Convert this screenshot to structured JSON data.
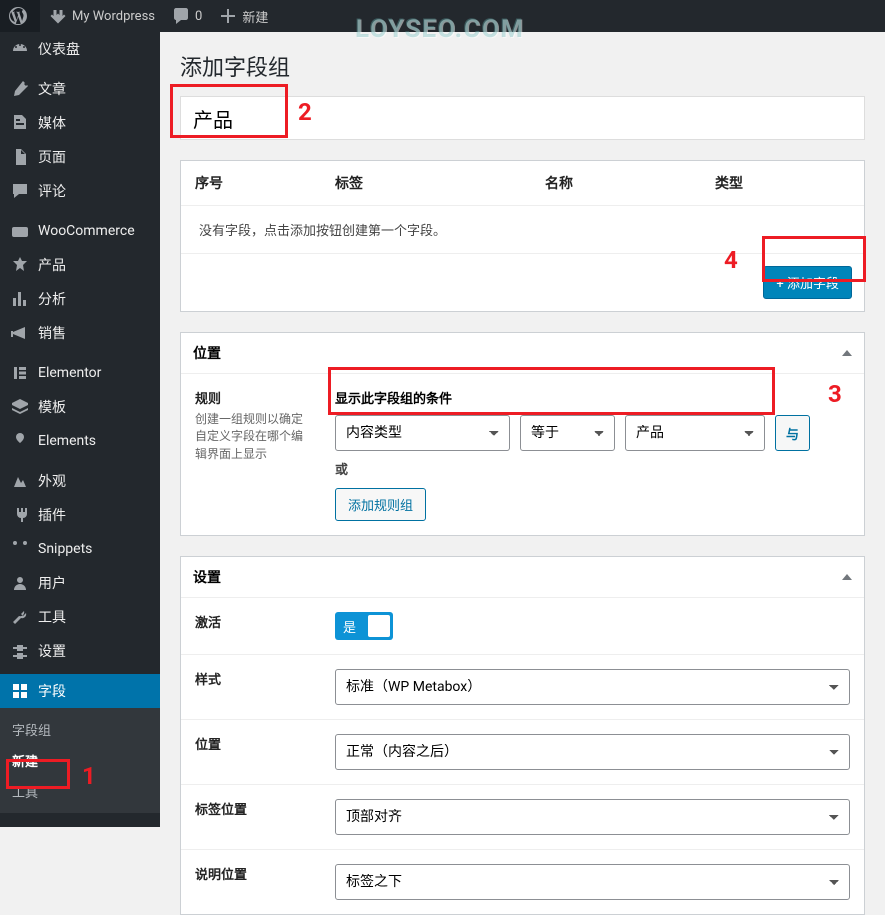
{
  "topbar": {
    "site": "My Wordpress",
    "comments": "0",
    "new": "新建"
  },
  "sidebar": {
    "items": [
      {
        "label": "仪表盘"
      },
      {
        "label": "文章"
      },
      {
        "label": "媒体"
      },
      {
        "label": "页面"
      },
      {
        "label": "评论"
      },
      {
        "label": "WooCommerce"
      },
      {
        "label": "产品"
      },
      {
        "label": "分析"
      },
      {
        "label": "销售"
      },
      {
        "label": "Elementor"
      },
      {
        "label": "模板"
      },
      {
        "label": "Elements"
      },
      {
        "label": "外观"
      },
      {
        "label": "插件"
      },
      {
        "label": "Snippets"
      },
      {
        "label": "用户"
      },
      {
        "label": "工具"
      },
      {
        "label": "设置"
      },
      {
        "label": "字段"
      }
    ],
    "sub": [
      {
        "label": "字段组"
      },
      {
        "label": "新建"
      },
      {
        "label": "工具"
      }
    ]
  },
  "page": {
    "heading": "添加字段组",
    "title_value": "产品"
  },
  "table": {
    "col_order": "序号",
    "col_label": "标签",
    "col_name": "名称",
    "col_type": "类型",
    "empty": "没有字段，点击添加按钮创建第一个字段。",
    "add": "+ 添加字段"
  },
  "location": {
    "title": "位置",
    "rules_label": "规则",
    "rules_desc": "创建一组规则以确定自定义字段在哪个编辑界面上显示",
    "rule_head": "显示此字段组的条件",
    "param": "内容类型",
    "operator": "等于",
    "value": "产品",
    "and": "与",
    "or": "或",
    "add_group": "添加规则组"
  },
  "settings": {
    "title": "设置",
    "active": "激活",
    "active_val": "是",
    "style": "样式",
    "style_val": "标准（WP Metabox）",
    "position": "位置",
    "position_val": "正常（内容之后）",
    "label_pos": "标签位置",
    "label_pos_val": "顶部对齐",
    "instr_pos": "说明位置",
    "instr_pos_val": "标签之下"
  },
  "watermark": "LOYSEO.COM"
}
